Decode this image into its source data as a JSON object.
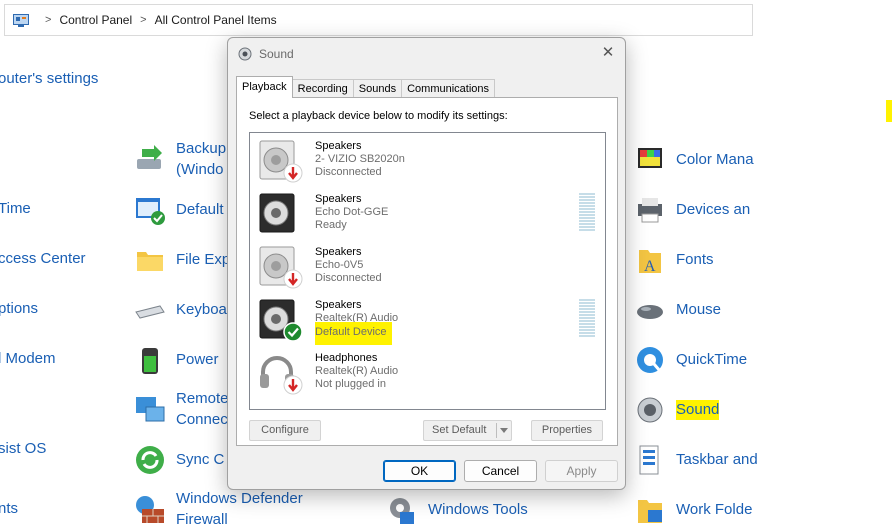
{
  "breadcrumb": {
    "items": [
      "Control Panel",
      "All Control Panel Items"
    ]
  },
  "page": {
    "heading": "outer's settings"
  },
  "items": {
    "backup": [
      "Backup",
      "(Windo"
    ],
    "default_programs": "Default",
    "file_explorer": "File Exp",
    "keyboard": "Keyboa",
    "power": "Power",
    "remote": [
      "Remote",
      "Connec"
    ],
    "sync": "Sync C",
    "defender": [
      "Windows Defender",
      "Firewall"
    ],
    "windows_tools": "Windows Tools",
    "color": "Color Mana",
    "devices": "Devices an",
    "fonts": "Fonts",
    "mouse": "Mouse",
    "quicktime": "QuickTime",
    "sound": "Sound",
    "taskbar": "Taskbar and",
    "work_folders": "Work Folde",
    "left_col": [
      "Time",
      "ccess Center",
      "ptions",
      "l Modem",
      "sist OS",
      "nts"
    ]
  },
  "dialog": {
    "title": "Sound",
    "close_glyph": "✕",
    "tabs": [
      "Playback",
      "Recording",
      "Sounds",
      "Communications"
    ],
    "active_tab": "Playback",
    "instruction": "Select a playback device below to modify its settings:",
    "devices": [
      {
        "name": "Speakers",
        "sub": "2- VIZIO SB2020n",
        "status": "Disconnected",
        "icon": "speaker-icon",
        "badge": "disconnected-badge-icon",
        "meter": false
      },
      {
        "name": "Speakers",
        "sub": "Echo Dot-GGE",
        "status": "Ready",
        "icon": "speaker-icon",
        "badge": "none",
        "meter": true
      },
      {
        "name": "Speakers",
        "sub": "Echo-0V5",
        "status": "Disconnected",
        "icon": "speaker-icon",
        "badge": "disconnected-badge-icon",
        "meter": false
      },
      {
        "name": "Speakers",
        "sub": "Realtek(R) Audio",
        "status": "Default Device",
        "icon": "speaker-icon",
        "badge": "default-check-icon",
        "meter": true
      },
      {
        "name": "Headphones",
        "sub": "Realtek(R) Audio",
        "status": "Not plugged in",
        "icon": "headphones-icon",
        "badge": "disconnected-badge-icon",
        "meter": false
      }
    ],
    "buttons": {
      "configure": "Configure",
      "set_default": "Set Default",
      "properties": "Properties",
      "ok": "OK",
      "cancel": "Cancel",
      "apply": "Apply"
    }
  },
  "colors": {
    "link": "#1a5fb4",
    "highlight": "#fff200",
    "accent": "#0067c0",
    "check": "#1e8a2e",
    "disconnected": "#d42626"
  }
}
